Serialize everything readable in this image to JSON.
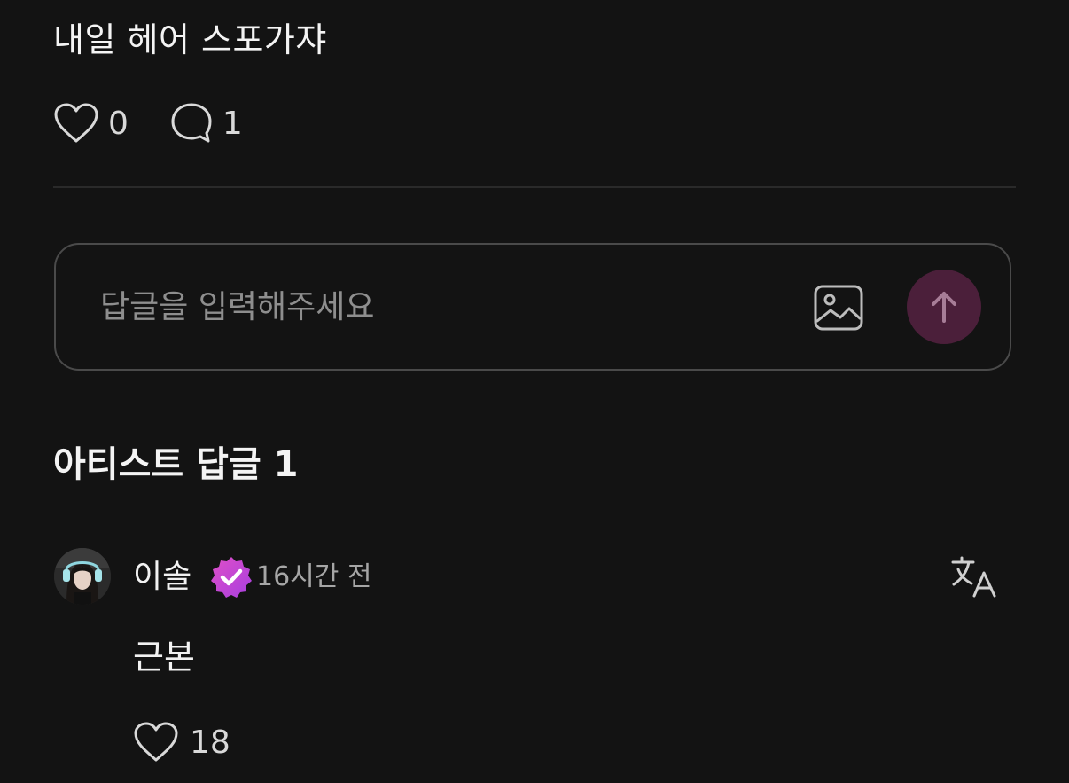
{
  "post": {
    "text": "내일 헤어 스포가쟈",
    "like_count": "0",
    "comment_count": "1"
  },
  "reply": {
    "placeholder": "답글을 입력해주세요"
  },
  "section": {
    "title": "아티스트 답글 1"
  },
  "comment": {
    "author": "이솔",
    "time": "16시간 전",
    "text": "근본",
    "like_count": "18"
  },
  "icons": {
    "like": "heart-icon",
    "comment": "speech-bubble-icon",
    "image": "image-icon",
    "send": "arrow-up-icon",
    "verified": "verified-badge-icon",
    "translate": "translate-icon"
  },
  "colors": {
    "background": "#131313",
    "send_button": "#4b1f3a",
    "verified_badge": "#c53fd6",
    "muted_text": "#a6a6a6"
  }
}
